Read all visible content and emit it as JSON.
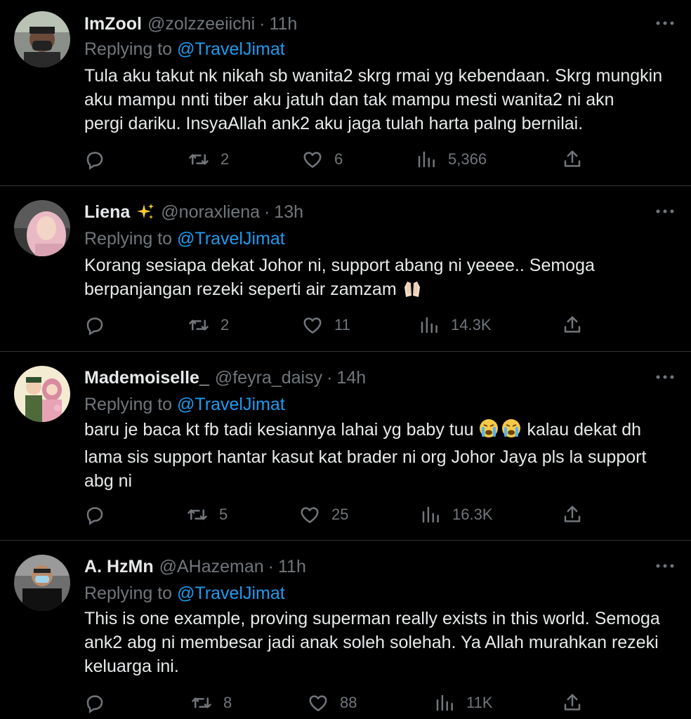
{
  "reply_label": "Replying to",
  "tweets": [
    {
      "name": "ImZool",
      "handle": "@zolzzeeiichi",
      "time": "11h",
      "mention": "@TravelJimat",
      "text": [
        "Tula aku takut nk nikah sb wanita2 skrg rmai yg kebendaan. Skrg mungkin",
        "aku mampu nnti tiber aku jatuh dan tak mampu mesti wanita2 ni akn",
        "pergi dariku. InsyaAllah ank2 aku jaga tulah harta palng bernilai."
      ],
      "retweets": "2",
      "likes": "6",
      "views": "5,366"
    },
    {
      "name": "Liena",
      "handle": "@noraxliena",
      "time": "13h",
      "mention": "@TravelJimat",
      "text": [
        "Korang sesiapa dekat Johor ni, support abang ni yeeee.. Semoga",
        "berpanjangan rezeki seperti air zamzam"
      ],
      "retweets": "2",
      "likes": "11",
      "views": "14.3K"
    },
    {
      "name": "Mademoiselle_",
      "handle": "@feyra_daisy",
      "time": "14h",
      "mention": "@TravelJimat",
      "text": [
        "baru je baca kt fb tadi kesiannya lahai yg baby tuu",
        "kalau dekat dh",
        "lama sis support hantar kasut kat brader ni org Johor Jaya pls la support",
        "abg ni"
      ],
      "retweets": "5",
      "likes": "25",
      "views": "16.3K"
    },
    {
      "name": "A. HzMn",
      "handle": "@AHazeman",
      "time": "11h",
      "mention": "@TravelJimat",
      "text": [
        "This is one example, proving superman really exists in this world. Semoga",
        "ank2 abg ni membesar jadi anak soleh solehah. Ya Allah murahkan rezeki",
        "keluarga ini."
      ],
      "retweets": "8",
      "likes": "88",
      "views": "11K"
    }
  ],
  "colors": {
    "background": "#000000",
    "text": "#e7e9ea",
    "muted": "#71767b",
    "link": "#1d9bf0",
    "divider": "#2f3336"
  },
  "icons": [
    "reply-icon",
    "retweet-icon",
    "like-icon",
    "views-icon",
    "share-icon",
    "more-icon"
  ]
}
